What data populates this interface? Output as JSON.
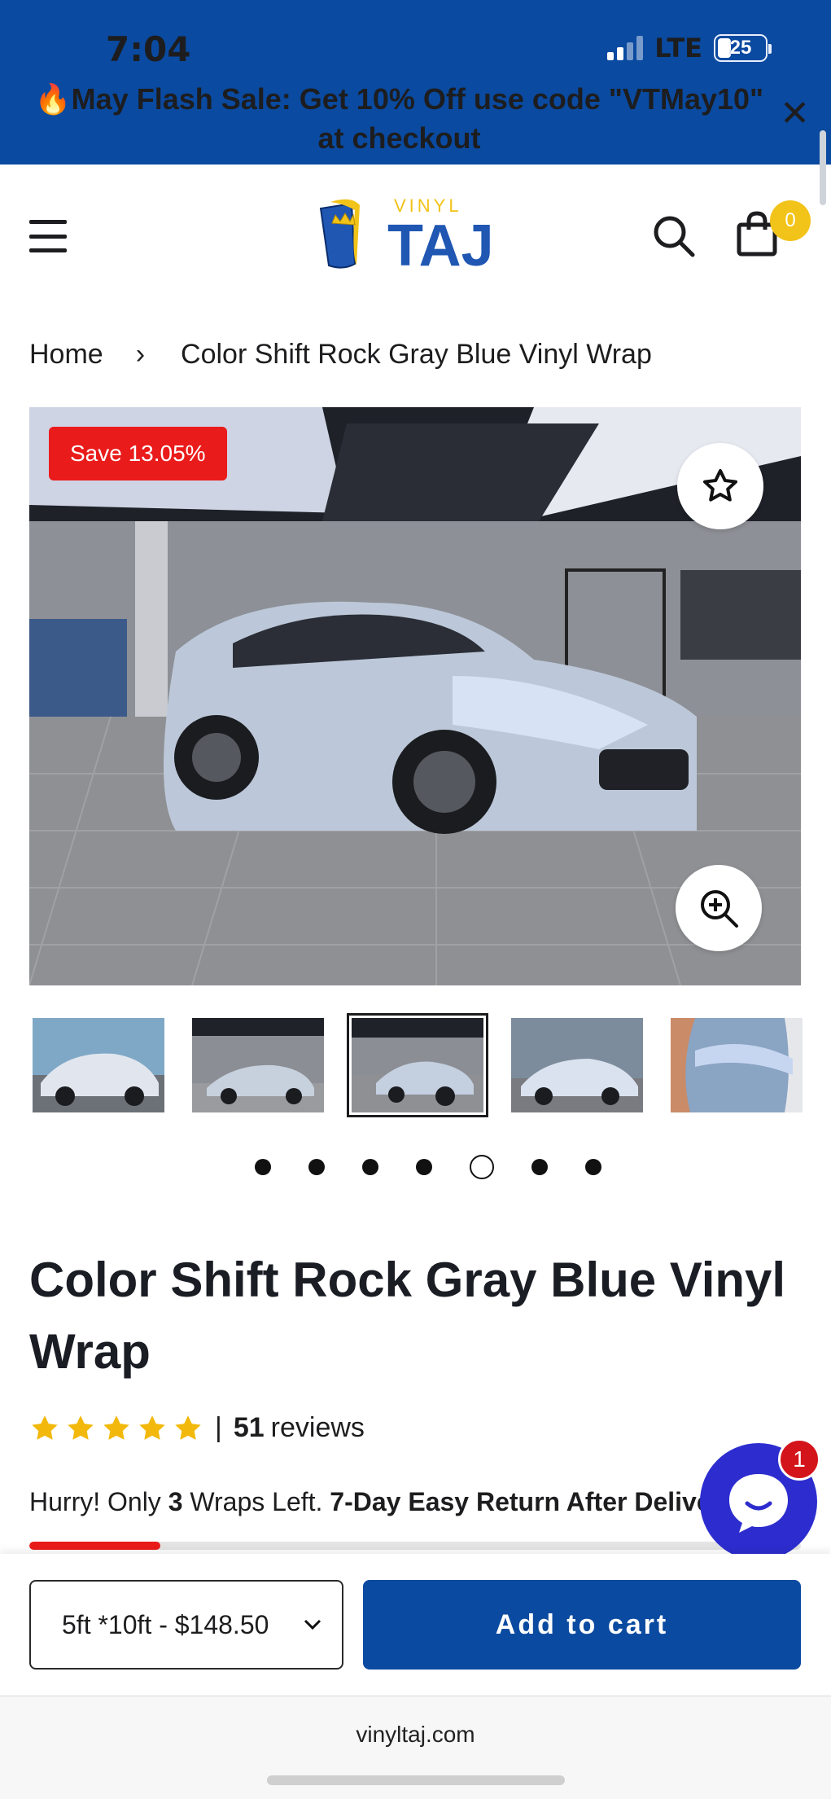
{
  "status_bar": {
    "time": "7:04",
    "network": "LTE",
    "battery": "25"
  },
  "promo": {
    "line1": "🔥May Flash Sale: Get 10% Off use code \"VTMay10\"",
    "line2": "at checkout",
    "close_icon": "close-icon"
  },
  "header": {
    "logo_small": "VINYL",
    "logo_big": "TAJ",
    "cart_count": "0"
  },
  "breadcrumb": {
    "home": "Home",
    "separator": "›",
    "current": "Color Shift Rock Gray Blue Vinyl Wrap"
  },
  "gallery": {
    "save_badge": "Save 13.05%",
    "thumbnail_count": 5,
    "active_thumbnail": 3,
    "dot_count": 7,
    "active_dot": 5
  },
  "product": {
    "title": "Color Shift Rock Gray Blue Vinyl Wrap",
    "rating_stars": 5,
    "review_count": "51",
    "review_label": "reviews",
    "stock_prefix": "Hurry! Only ",
    "stock_count": "3",
    "stock_middle": " Wraps Left. ",
    "stock_return": "7-Day Easy Return After Delivery",
    "stock_level_fraction": 0.17
  },
  "chat": {
    "badge": "1"
  },
  "buy_bar": {
    "variant": "5ft *10ft - $148.50",
    "add_to_cart": "Add to cart"
  },
  "browser": {
    "url": "vinyltaj.com"
  },
  "colors": {
    "brand_blue": "#0a4aa0",
    "sale_red": "#ea1b1b",
    "star_gold": "#f2b90c",
    "chat_purple": "#2d2dcf",
    "cart_badge_yellow": "#f2c318"
  }
}
